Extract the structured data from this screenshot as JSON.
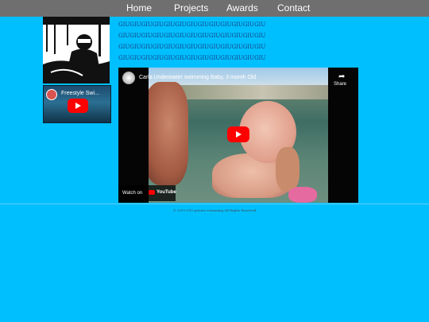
{
  "nav": {
    "items": [
      "Home",
      "Projects",
      "Awards",
      "Contact"
    ]
  },
  "sidebar": {
    "video_title": "Freestyle Swi..."
  },
  "main": {
    "gibberish_lines": [
      "GIUGIUGIUGIUGIUGIUGIUGIUGIUGIUGIUGIUGIU",
      "GIUGIUGIUGIUGIUGIUGIUGIUGIUGIUGIUGIUGIU",
      "GIUGIUGIUGIUGIUGIUGIUGIUGIUGIUGIUGIUGIU",
      "GIUGIUGIUGIUGIUGIUGIUGIUGIUGIUGIUGIUGIU"
    ],
    "video": {
      "title": "Carla Underwater swimming Baby, 3 month Old",
      "share_label": "Share",
      "watch_on_label": "Watch on",
      "platform": "YouTube"
    }
  },
  "footer": {
    "text": "© 2015 OTO private swimming All Rights Reserved"
  },
  "colors": {
    "page_background": "#00bfff",
    "nav_background": "#6f6f6f",
    "youtube_red": "#ff0000"
  }
}
